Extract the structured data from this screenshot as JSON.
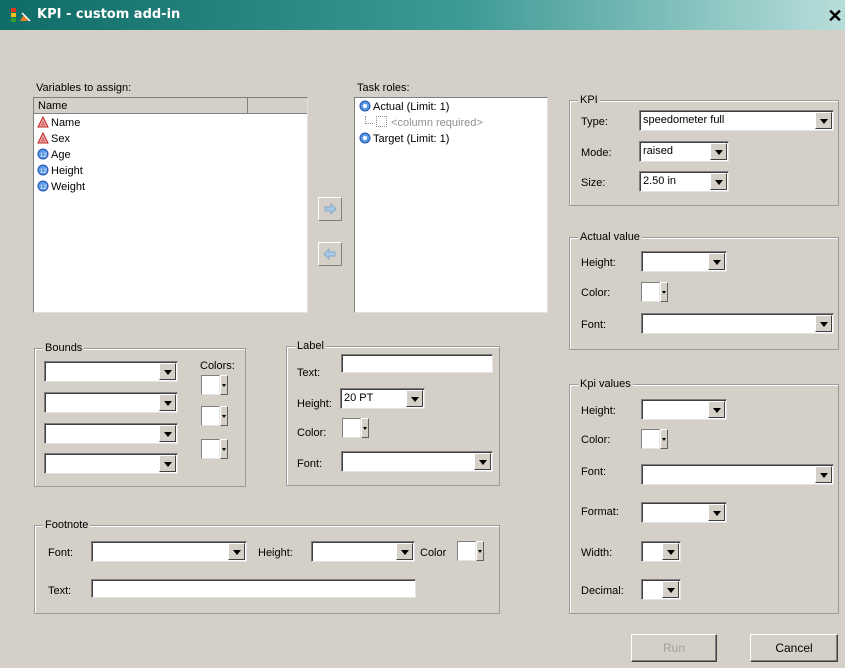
{
  "window": {
    "title": "KPI - custom add-in",
    "close_glyph": "✕"
  },
  "variables": {
    "label": "Variables to assign:",
    "column_header": "Name",
    "items": [
      {
        "name": "Name",
        "icon": "character-variable-icon"
      },
      {
        "name": "Sex",
        "icon": "character-variable-icon"
      },
      {
        "name": "Age",
        "icon": "numeric-variable-icon"
      },
      {
        "name": "Height",
        "icon": "numeric-variable-icon"
      },
      {
        "name": "Weight",
        "icon": "numeric-variable-icon"
      }
    ]
  },
  "task_roles": {
    "label": "Task roles:",
    "actual": "Actual  (Limit: 1)",
    "column_required": "<column required>",
    "target": "Target  (Limit: 1)"
  },
  "kpi": {
    "group_label": "KPI",
    "type_label": "Type:",
    "type_value": "speedometer full",
    "mode_label": "Mode:",
    "mode_value": "raised",
    "size_label": "Size:",
    "size_value": "2.50 in"
  },
  "actual_value": {
    "group_label": "Actual value",
    "height_label": "Height:",
    "height_value": "",
    "color_label": "Color:",
    "font_label": "Font:",
    "font_value": ""
  },
  "kpi_values": {
    "group_label": "Kpi values",
    "height_label": "Height:",
    "height_value": "",
    "color_label": "Color:",
    "font_label": "Font:",
    "font_value": "",
    "format_label": "Format:",
    "format_value": "",
    "width_label": "Width:",
    "width_value": "",
    "decimal_label": "Decimal:",
    "decimal_value": ""
  },
  "bounds": {
    "group_label": "Bounds",
    "colors_label": "Colors:",
    "values": [
      "",
      "",
      "",
      ""
    ]
  },
  "label": {
    "group_label": "Label",
    "text_label": "Text:",
    "text_value": "",
    "height_label": "Height:",
    "height_value": "20 PT",
    "color_label": "Color:",
    "font_label": "Font:",
    "font_value": ""
  },
  "footnote": {
    "group_label": "Footnote",
    "font_label": "Font:",
    "font_value": "",
    "height_label": "Height:",
    "height_value": "",
    "color_label": "Color",
    "text_label": "Text:",
    "text_value": ""
  },
  "buttons": {
    "run": "Run",
    "cancel": "Cancel"
  },
  "colors": {
    "titlebar": "#0f6b66",
    "dialog": "#d4d0c8",
    "swatch": "#ffffff"
  }
}
